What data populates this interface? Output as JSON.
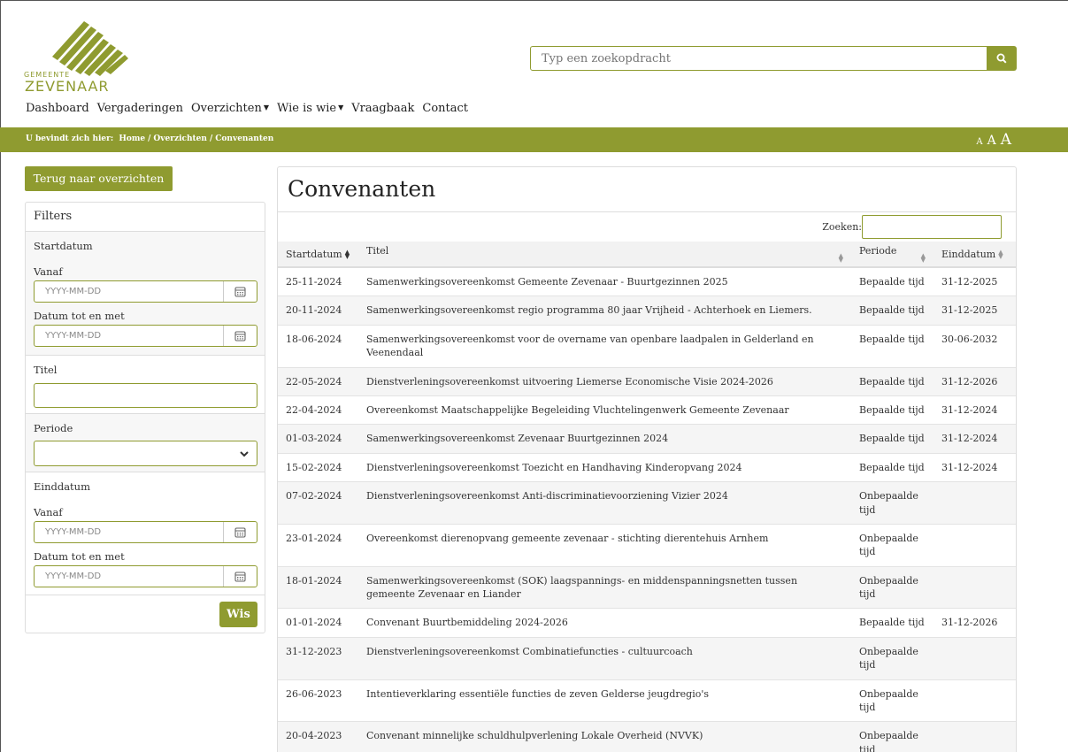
{
  "header": {
    "logo_small": "GEMEENTE",
    "logo_big": "ZEVENAAR",
    "search_placeholder": "Typ een zoekopdracht",
    "nav": [
      {
        "label": "Dashboard",
        "dropdown": false
      },
      {
        "label": "Vergaderingen",
        "dropdown": false
      },
      {
        "label": "Overzichten",
        "dropdown": true
      },
      {
        "label": "Wie is wie",
        "dropdown": true
      },
      {
        "label": "Vraagbaak",
        "dropdown": false
      },
      {
        "label": "Contact",
        "dropdown": false
      }
    ]
  },
  "breadcrumb": {
    "prefix": "U bevindt zich hier:",
    "items": [
      "Home",
      "Overzichten",
      "Convenanten"
    ],
    "font_sizes": [
      "A",
      "A",
      "A"
    ]
  },
  "sidebar": {
    "back_label": "Terug naar overzichten",
    "filters_title": "Filters",
    "startdatum": "Startdatum",
    "vanaf": "Vanaf",
    "tot_en_met": "Datum tot en met",
    "date_placeholder": "YYYY-MM-DD",
    "titel": "Titel",
    "periode": "Periode",
    "einddatum": "Einddatum",
    "vanaf2": "Vanaf",
    "tot_en_met2": "Datum tot en met",
    "wis_label": "Wis"
  },
  "main": {
    "title": "Convenanten",
    "search_label": "Zoeken:",
    "columns": [
      "Startdatum",
      "Titel",
      "Periode",
      "Einddatum"
    ],
    "rows": [
      {
        "start": "25-11-2024",
        "titel": "Samenwerkingsovereenkomst Gemeente Zevenaar - Buurtgezinnen 2025",
        "periode": "Bepaalde tijd",
        "eind": "31-12-2025"
      },
      {
        "start": "20-11-2024",
        "titel": "Samenwerkingsovereenkomst regio programma 80 jaar Vrijheid - Achterhoek en Liemers.",
        "periode": "Bepaalde tijd",
        "eind": "31-12-2025"
      },
      {
        "start": "18-06-2024",
        "titel": "Samenwerkingsovereenkomst voor de overname van openbare laadpalen in Gelderland en Veenendaal",
        "periode": "Bepaalde tijd",
        "eind": "30-06-2032"
      },
      {
        "start": "22-05-2024",
        "titel": "Dienstverleningsovereenkomst uitvoering Liemerse Economische Visie 2024-2026",
        "periode": "Bepaalde tijd",
        "eind": "31-12-2026"
      },
      {
        "start": "22-04-2024",
        "titel": "Overeenkomst Maatschappelijke Begeleiding Vluchtelingenwerk Gemeente Zevenaar",
        "periode": "Bepaalde tijd",
        "eind": "31-12-2024"
      },
      {
        "start": "01-03-2024",
        "titel": "Samenwerkingsovereenkomst Zevenaar Buurtgezinnen 2024",
        "periode": "Bepaalde tijd",
        "eind": "31-12-2024"
      },
      {
        "start": "15-02-2024",
        "titel": "Dienstverleningsovereenkomst Toezicht en Handhaving Kinderopvang 2024",
        "periode": "Bepaalde tijd",
        "eind": "31-12-2024"
      },
      {
        "start": "07-02-2024",
        "titel": "Dienstverleningsovereenkomst Anti-discriminatievoorziening Vizier 2024",
        "periode": "Onbepaalde tijd",
        "eind": ""
      },
      {
        "start": "23-01-2024",
        "titel": "Overeenkomst dierenopvang gemeente zevenaar - stichting dierentehuis Arnhem",
        "periode": "Onbepaalde tijd",
        "eind": ""
      },
      {
        "start": "18-01-2024",
        "titel": "Samenwerkingsovereenkomst (SOK) laagspannings- en middenspanningsnetten tussen gemeente Zevenaar en Liander",
        "periode": "Onbepaalde tijd",
        "eind": ""
      },
      {
        "start": "01-01-2024",
        "titel": "Convenant Buurtbemiddeling 2024-2026",
        "periode": "Bepaalde tijd",
        "eind": "31-12-2026"
      },
      {
        "start": "31-12-2023",
        "titel": "Dienstverleningsovereenkomst Combinatiefuncties - cultuurcoach",
        "periode": "Onbepaalde tijd",
        "eind": ""
      },
      {
        "start": "26-06-2023",
        "titel": "Intentieverklaring essentiële functies de zeven Gelderse jeugdregio's",
        "periode": "Onbepaalde tijd",
        "eind": ""
      },
      {
        "start": "20-04-2023",
        "titel": "Convenant minnelijke schuldhulpverlening Lokale Overheid (NVVK)",
        "periode": "Onbepaalde tijd",
        "eind": ""
      }
    ]
  },
  "colors": {
    "accent": "#8f9b30",
    "row_alt": "#f5f5f5"
  },
  "icons": {
    "search": "search-icon",
    "calendar": "calendar-icon",
    "chevron": "chevron-down-icon",
    "sort": "sort-icon",
    "caret": "caret-down-icon"
  }
}
